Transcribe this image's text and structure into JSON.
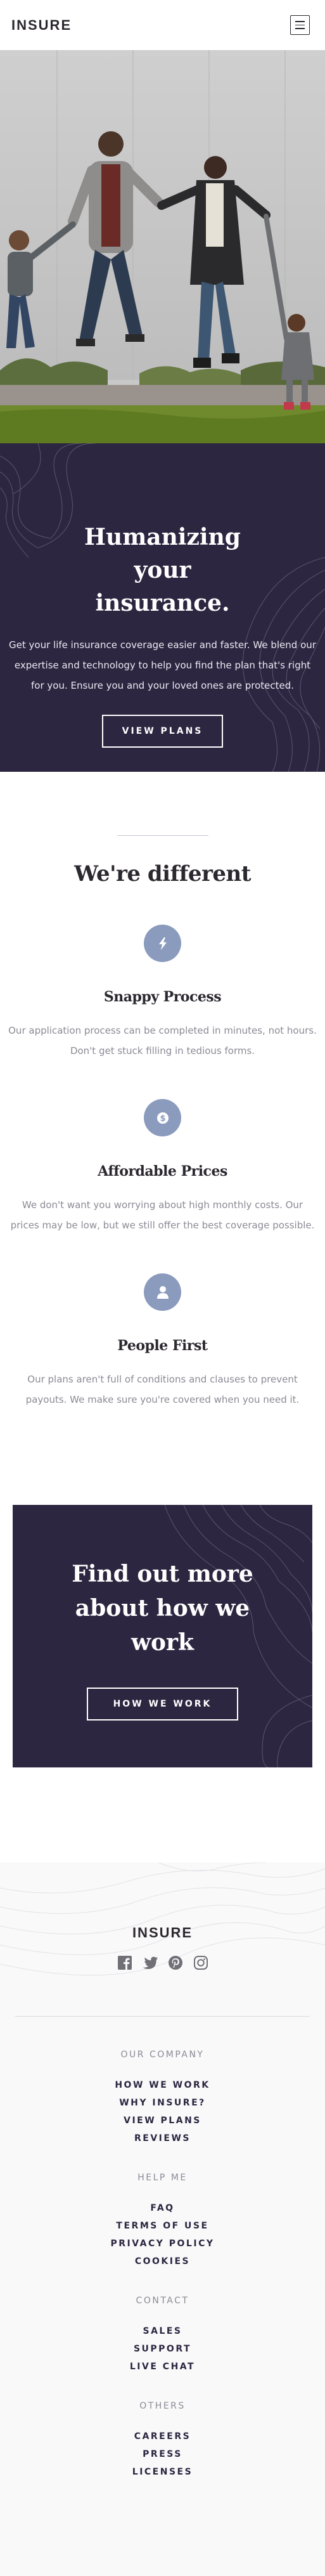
{
  "header": {
    "logo": "INSURE",
    "menu_icon": "hamburger-icon"
  },
  "hero": {
    "title": "Humanizing your insurance.",
    "description": "Get your life insurance coverage easier and faster. We blend our expertise and technology to help you find the plan that's right for you. Ensure you and your loved ones are protected.",
    "button": "VIEW PLANS"
  },
  "different": {
    "title": "We're different",
    "features": [
      {
        "icon": "lightning-icon",
        "title": "Snappy Process",
        "description": "Our application process can be completed in minutes, not hours. Don't get stuck filling in tedious forms."
      },
      {
        "icon": "dollar-icon",
        "title": "Affordable Prices",
        "description": "We don't want you worrying about high monthly costs. Our prices may be low, but we still offer the best coverage possible."
      },
      {
        "icon": "person-icon",
        "title": "People First",
        "description": "Our plans aren't full of conditions and clauses to prevent payouts. We make sure you're covered when you need it."
      }
    ]
  },
  "cta": {
    "title": "Find out more about how we work",
    "button": "HOW WE WORK"
  },
  "footer": {
    "logo": "INSURE",
    "socials": [
      "facebook-icon",
      "twitter-icon",
      "pinterest-icon",
      "instagram-icon"
    ],
    "groups": [
      {
        "heading": "OUR COMPANY",
        "links": [
          "HOW WE WORK",
          "WHY INSURE?",
          "VIEW PLANS",
          "REVIEWS"
        ]
      },
      {
        "heading": "HELP ME",
        "links": [
          "FAQ",
          "TERMS OF USE",
          "PRIVACY POLICY",
          "COOKIES"
        ]
      },
      {
        "heading": "CONTACT",
        "links": [
          "SALES",
          "SUPPORT",
          "LIVE CHAT"
        ]
      },
      {
        "heading": "OTHERS",
        "links": [
          "CAREERS",
          "PRESS",
          "LICENSES"
        ]
      }
    ]
  },
  "colors": {
    "dark_violet": "#2c2640",
    "icon_blue": "#8a9bbd",
    "text_gray": "#8c8a95"
  }
}
